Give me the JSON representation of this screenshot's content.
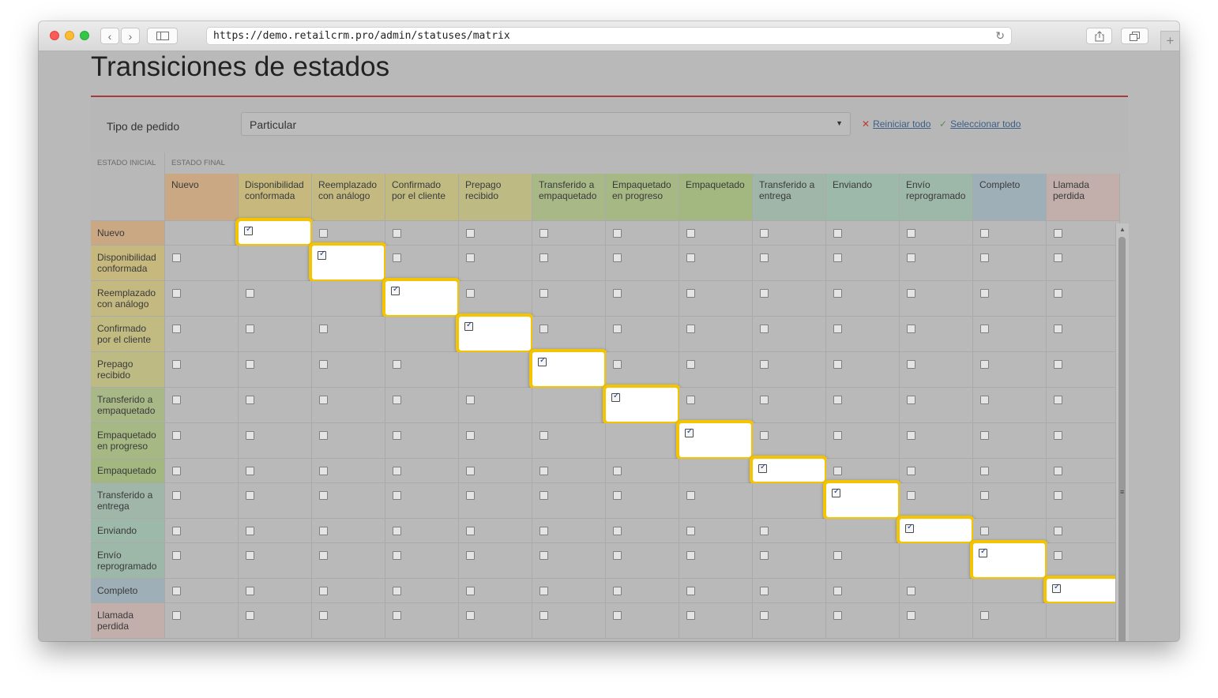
{
  "browser": {
    "url": "https://demo.retailcrm.pro/admin/statuses/matrix",
    "back_icon": "chevron-left-icon",
    "forward_icon": "chevron-right-icon",
    "sidebar_icon": "sidebar-icon",
    "reload_icon": "reload-icon",
    "share_icon": "share-icon",
    "tabs_icon": "tabs-icon",
    "new_tab_icon": "plus-icon"
  },
  "page": {
    "title": "Transiciones de estados"
  },
  "filter": {
    "label": "Tipo de pedido",
    "selected": "Particular",
    "reset_label": "Reiniciar todo",
    "select_all_label": "Seleccionar todo"
  },
  "matrix": {
    "initial_label": "ESTADO INICIAL",
    "final_label": "ESTADO FINAL",
    "statuses": [
      {
        "name": "Nuevo",
        "color": "#c9a883"
      },
      {
        "name": "Disponibilidad conformada",
        "color": "#c7b87e"
      },
      {
        "name": "Reemplazado con análogo",
        "color": "#c4b980"
      },
      {
        "name": "Confirmado por el cliente",
        "color": "#c1bb82"
      },
      {
        "name": "Prepago recibido",
        "color": "#bdbb83"
      },
      {
        "name": "Transferido a empaquetado",
        "color": "#a8b886"
      },
      {
        "name": "Empaquetado en progreso",
        "color": "#a6b883"
      },
      {
        "name": "Empaquetado",
        "color": "#a3b880"
      },
      {
        "name": "Transferido a entrega",
        "color": "#9fb6a8"
      },
      {
        "name": "Enviando",
        "color": "#9db9aa"
      },
      {
        "name": "Envío reprogramado",
        "color": "#9db8a9"
      },
      {
        "name": "Completo",
        "color": "#9eafb8"
      },
      {
        "name": "Llamada perdida",
        "color": "#c2aeaa"
      }
    ],
    "checked_transitions": [
      [
        0,
        1
      ],
      [
        1,
        2
      ],
      [
        2,
        3
      ],
      [
        3,
        4
      ],
      [
        4,
        5
      ],
      [
        5,
        6
      ],
      [
        6,
        7
      ],
      [
        7,
        8
      ],
      [
        8,
        9
      ],
      [
        9,
        10
      ],
      [
        10,
        11
      ],
      [
        11,
        12
      ]
    ],
    "highlight_color": "#f5c400",
    "checkmark": "✓"
  }
}
